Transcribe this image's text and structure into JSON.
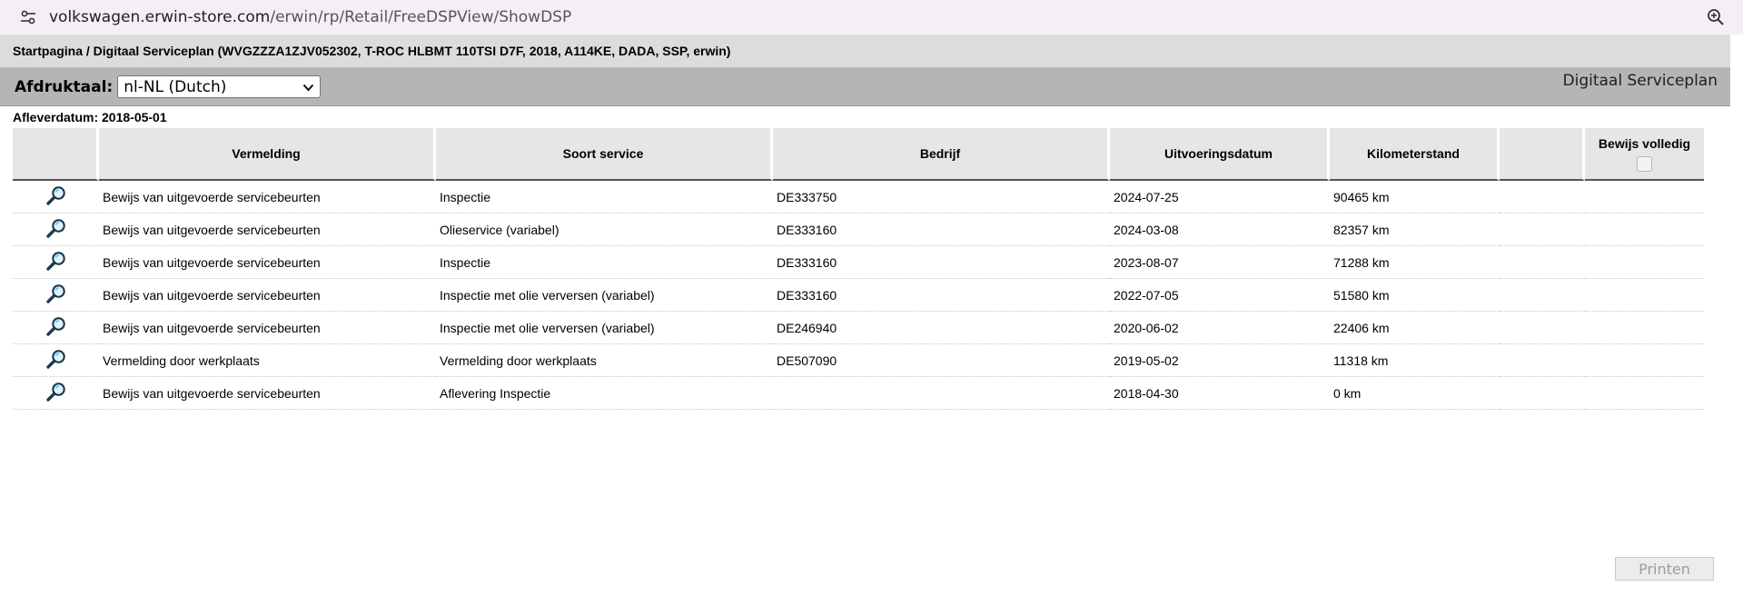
{
  "browser": {
    "url_host": "volkswagen.erwin-store.com",
    "url_path": "/erwin/rp/Retail/FreeDSPView/ShowDSP"
  },
  "breadcrumb": "Startpagina / Digitaal Serviceplan (WVGZZZA1ZJV052302, T-ROC HLBMT 110TSI D7F, 2018, A114KE, DADA, SSP, erwin)",
  "toolbar": {
    "language_label": "Afdruktaal:",
    "language_value": "nl-NL (Dutch)",
    "title": "Digitaal Serviceplan"
  },
  "delivery_date": "Afleverdatum: 2018-05-01",
  "table": {
    "headers": [
      "",
      "Vermelding",
      "Soort service",
      "Bedrijf",
      "Uitvoeringsdatum",
      "Kilometerstand",
      "",
      "Bewijs volledig"
    ],
    "rows": [
      {
        "vermelding": "Bewijs van uitgevoerde servicebeurten",
        "soort": "Inspectie",
        "bedrijf": "DE333750",
        "datum": "2024-07-25",
        "km": "90465 km"
      },
      {
        "vermelding": "Bewijs van uitgevoerde servicebeurten",
        "soort": "Olieservice (variabel)",
        "bedrijf": "DE333160",
        "datum": "2024-03-08",
        "km": "82357 km"
      },
      {
        "vermelding": "Bewijs van uitgevoerde servicebeurten",
        "soort": "Inspectie",
        "bedrijf": "DE333160",
        "datum": "2023-08-07",
        "km": "71288 km"
      },
      {
        "vermelding": "Bewijs van uitgevoerde servicebeurten",
        "soort": "Inspectie met olie verversen (variabel)",
        "bedrijf": "DE333160",
        "datum": "2022-07-05",
        "km": "51580 km"
      },
      {
        "vermelding": "Bewijs van uitgevoerde servicebeurten",
        "soort": "Inspectie met olie verversen (variabel)",
        "bedrijf": "DE246940",
        "datum": "2020-06-02",
        "km": "22406 km"
      },
      {
        "vermelding": "Vermelding door werkplaats",
        "soort": "Vermelding door werkplaats",
        "bedrijf": "DE507090",
        "datum": "2019-05-02",
        "km": "11318 km"
      },
      {
        "vermelding": "Bewijs van uitgevoerde servicebeurten",
        "soort": "Aflevering Inspectie",
        "bedrijf": "",
        "datum": "2018-04-30",
        "km": "0 km"
      }
    ]
  },
  "print_label": "Printen",
  "icons": {
    "view_record": "magnifier-icon",
    "site_settings": "tune-icon",
    "zoom": "zoom-in-icon"
  }
}
